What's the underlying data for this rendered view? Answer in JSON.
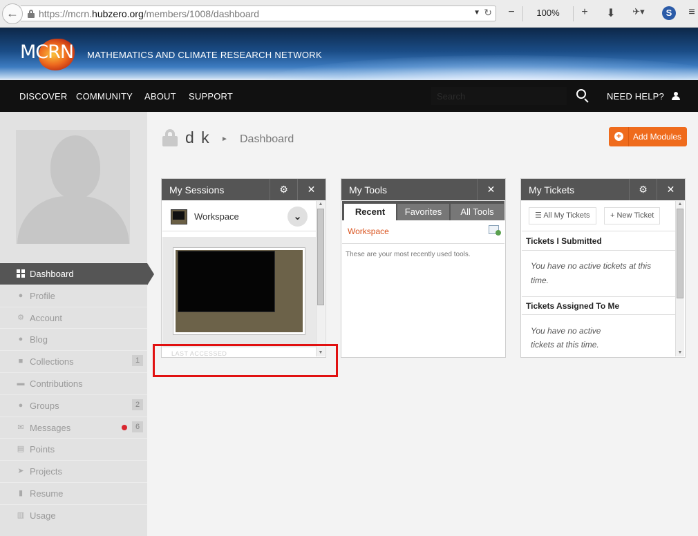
{
  "browser": {
    "url_prefix": "https://mcrn.",
    "url_domain": "hubzero.org",
    "url_path": "/members/1008/dashboard",
    "zoom": "100%"
  },
  "header": {
    "logo_text": "MCRN",
    "tagline": "MATHEMATICS AND CLIMATE RESEARCH NETWORK"
  },
  "nav": {
    "items": [
      "DISCOVER",
      "COMMUNITY",
      "ABOUT",
      "SUPPORT"
    ],
    "search_placeholder": "Search",
    "help": "NEED HELP?"
  },
  "sidebar": {
    "items": [
      {
        "label": "Dashboard",
        "icon": "grid-icon"
      },
      {
        "label": "Profile",
        "icon": "user-icon"
      },
      {
        "label": "Account",
        "icon": "gears-icon"
      },
      {
        "label": "Blog",
        "icon": "comment-icon"
      },
      {
        "label": "Collections",
        "icon": "collections-icon",
        "count": "1"
      },
      {
        "label": "Contributions",
        "icon": "folder-icon"
      },
      {
        "label": "Groups",
        "icon": "users-icon",
        "count": "2"
      },
      {
        "label": "Messages",
        "icon": "envelope-icon",
        "count": "6"
      },
      {
        "label": "Points",
        "icon": "coins-icon"
      },
      {
        "label": "Projects",
        "icon": "send-icon"
      },
      {
        "label": "Resume",
        "icon": "document-icon"
      },
      {
        "label": "Usage",
        "icon": "chart-icon"
      }
    ]
  },
  "page": {
    "user_name": "d k",
    "crumb": "Dashboard",
    "add_modules": "Add Modules"
  },
  "sessions": {
    "title": "My Sessions",
    "session_name": "Workspace",
    "last_accessed": "LAST ACCESSED"
  },
  "tools": {
    "title": "My Tools",
    "tabs": [
      "Recent",
      "Favorites",
      "All Tools"
    ],
    "tool": "Workspace",
    "note": "These are your most recently used tools."
  },
  "tickets": {
    "title": "My Tickets",
    "all_btn": "All My Tickets",
    "new_btn": "New Ticket",
    "submitted_title": "Tickets I Submitted",
    "submitted_empty_1": "You have no active tickets at this",
    "submitted_empty_2": "time.",
    "assigned_title": "Tickets Assigned To Me",
    "assigned_empty_1": "You have no active",
    "assigned_empty_2": "tickets at this time."
  },
  "colors": {
    "accent": "#ef6b1c",
    "nav_bg": "#111111",
    "module_head": "#555555",
    "highlight": "#e11010"
  }
}
